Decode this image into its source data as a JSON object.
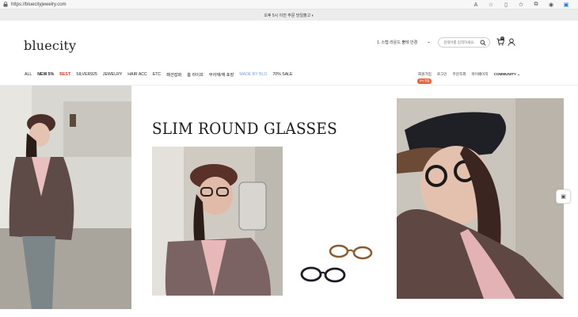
{
  "browser": {
    "url": "https://bluecityjewelry.com",
    "icons": [
      "text-size-icon",
      "favorite-star-icon",
      "split-view-icon",
      "favorites-icon",
      "collections-icon",
      "profile-icon",
      "extension-icon"
    ]
  },
  "announcement": "오후 5시 이전 주문 당일출고 ◐",
  "header": {
    "logo": "bluecity",
    "select_value": "1. 스텝 라운드 뿔테 안경",
    "search_placeholder": "검색어를 입력하세요",
    "cart_count": "0"
  },
  "nav": {
    "items": [
      {
        "label": "ALL",
        "style": "normal"
      },
      {
        "label": "NEW 5%",
        "style": "bold"
      },
      {
        "label": "BEST",
        "style": "red"
      },
      {
        "label": "SILVER925",
        "style": "normal"
      },
      {
        "label": "JEWELRY",
        "style": "normal"
      },
      {
        "label": "HAIR ACC",
        "style": "normal"
      },
      {
        "label": "ETC",
        "style": "normal"
      },
      {
        "label": "패션잡화",
        "style": "normal"
      },
      {
        "label": "홈 라이프",
        "style": "normal"
      },
      {
        "label": "부자재/재 포장",
        "style": "normal"
      },
      {
        "label": "MADE BY BLO",
        "style": "blue"
      },
      {
        "label": "70% SALE",
        "style": "normal"
      }
    ],
    "right": [
      "회원가입",
      "로그인",
      "주문조회",
      "마이페이지",
      "COMMUNITY ⌄"
    ],
    "join_badge": "5% 적립"
  },
  "hero": {
    "title": "SLIM ROUND GLASSES"
  },
  "colors": {
    "red": "#d53b2a",
    "blue_link": "#7fa0d6",
    "badge_orange": "#e7673f"
  }
}
